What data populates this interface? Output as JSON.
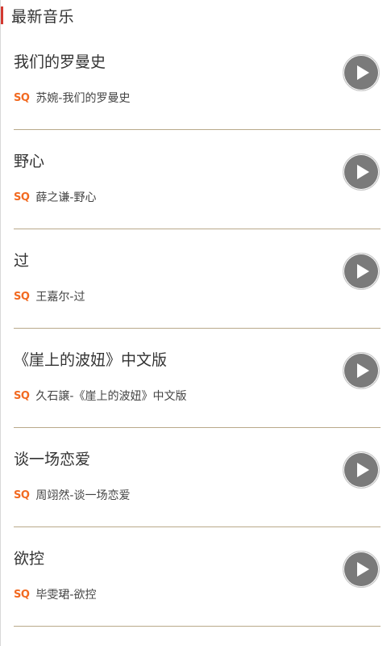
{
  "section": {
    "title": "最新音乐"
  },
  "quality_badge": "SQ",
  "songs": [
    {
      "title": "我们的罗曼史",
      "subtitle": "苏婉-我们的罗曼史"
    },
    {
      "title": "野心",
      "subtitle": "薛之谦-野心"
    },
    {
      "title": "过",
      "subtitle": "王嘉尔-过"
    },
    {
      "title": "《崖上的波妞》中文版",
      "subtitle": "久石譲-《崖上的波妞》中文版"
    },
    {
      "title": "谈一场恋爱",
      "subtitle": "周翊然-谈一场恋爱"
    },
    {
      "title": "欲控",
      "subtitle": "毕雯珺-欲控"
    }
  ],
  "colors": {
    "accent": "#d33a31",
    "sq_badge": "#f26a21",
    "play_button": "#7a7a7a",
    "divider": "#b9a98a"
  },
  "icons": {
    "play": "play-icon"
  }
}
